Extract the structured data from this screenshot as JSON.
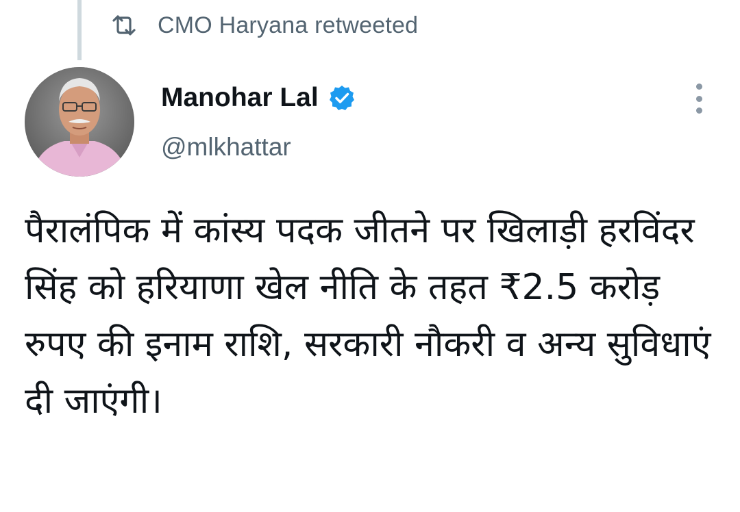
{
  "retweet_banner": {
    "icon": "retweet-icon",
    "text": "CMO Haryana retweeted"
  },
  "author": {
    "avatar_icon": "profile-photo",
    "name": "Manohar Lal",
    "verified_icon": "verified-badge-icon",
    "handle": "@mlkhattar"
  },
  "more_menu": {
    "icon": "more-vertical-icon"
  },
  "tweet": {
    "text": "पैरालंपिक में कांस्य पदक जीतने पर खिलाड़ी हरविंदर सिंह को हरियाणा खेल नीति के तहत ₹2.5 करोड़ रुपए की इनाम राशि, सरकारी नौकरी व अन्य सुविधाएं दी जाएंगी।"
  },
  "colors": {
    "primary_text": "#0f1419",
    "secondary_text": "#536471",
    "verified_blue": "#1d9bf0",
    "thread_line": "#cfd9de"
  }
}
